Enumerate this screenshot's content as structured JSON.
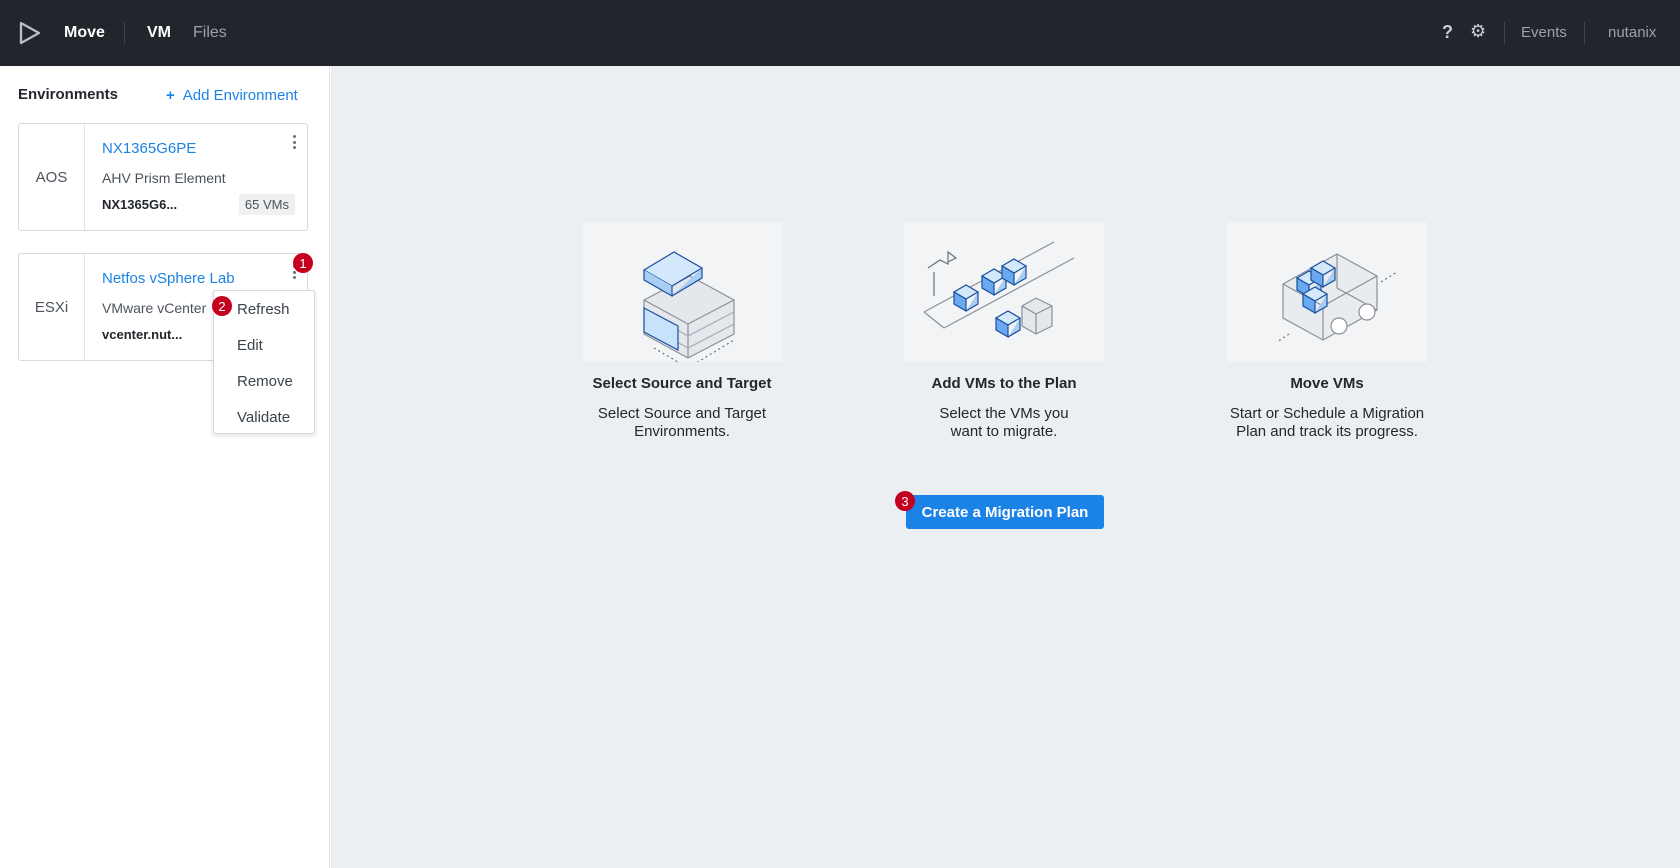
{
  "app": {
    "name": "Move",
    "nav": {
      "vm": "VM",
      "files": "Files"
    },
    "help": "?",
    "events": "Events",
    "user": "nutanix"
  },
  "sidebar": {
    "title": "Environments",
    "add_label": "Add Environment",
    "add_icon": "+",
    "environments": [
      {
        "type": "AOS",
        "name": "NX1365G6PE",
        "kind": "AHV Prism Element",
        "host": "NX1365G6...",
        "vm_count": "65 VMs"
      },
      {
        "type": "ESXi",
        "name": "Netfos vSphere Lab",
        "kind": "VMware vCenter",
        "host": "vcenter.nut..."
      }
    ]
  },
  "menu": {
    "items": [
      "Refresh",
      "Edit",
      "Remove",
      "Validate"
    ]
  },
  "steps": [
    {
      "title": "Select Source and Target",
      "desc_line1": "Select Source and Target",
      "desc_line2": "Environments."
    },
    {
      "title": "Add VMs to the Plan",
      "desc_line1": "Select the VMs you",
      "desc_line2": "want to migrate."
    },
    {
      "title": "Move VMs",
      "desc_line1": "Start or Schedule a Migration",
      "desc_line2": "Plan and track its progress."
    }
  ],
  "create_button": "Create a Migration Plan",
  "annotations": [
    "1",
    "2",
    "3"
  ],
  "colors": {
    "accent": "#1b82e6",
    "topbar": "#22262c",
    "badge": "#c5001f"
  }
}
